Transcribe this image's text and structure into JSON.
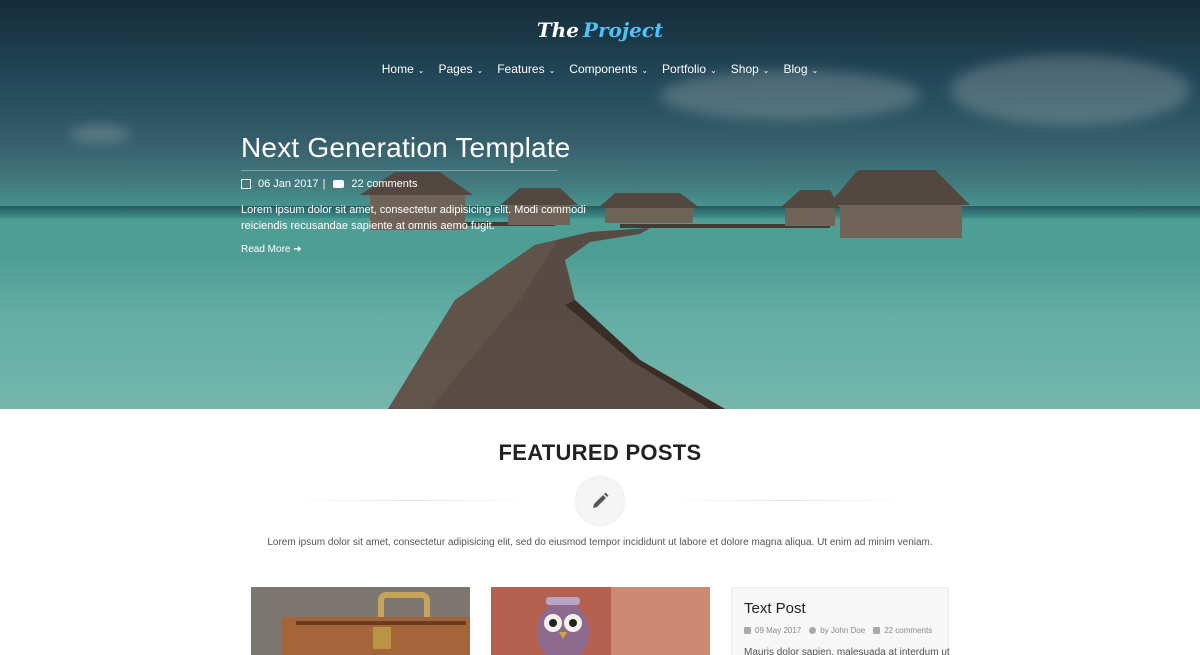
{
  "brand": {
    "name_part1": "The",
    "name_part2": "Project"
  },
  "nav": {
    "items": [
      {
        "label": "Home"
      },
      {
        "label": "Pages"
      },
      {
        "label": "Features"
      },
      {
        "label": "Components"
      },
      {
        "label": "Portfolio"
      },
      {
        "label": "Shop"
      },
      {
        "label": "Blog"
      }
    ]
  },
  "hero": {
    "title": "Next Generation Template",
    "date": "06 Jan 2017",
    "separator": "|",
    "comments": "22 comments",
    "description": "Lorem ipsum dolor sit amet, consectetur adipisicing elit. Modi commodi reiciendis recusandae sapiente at omnis aemo fugit.",
    "read_more": "Read More"
  },
  "featured": {
    "title": "FEATURED POSTS",
    "description": "Lorem ipsum dolor sit amet, consectetur adipisicing elit, sed do eiusmod tempor incididunt ut labore et dolore magna aliqua. Ut enim ad minim veniam."
  },
  "text_post": {
    "title": "Text Post",
    "date": "09 May 2017",
    "author": "by John Doe",
    "comments": "22 comments",
    "excerpt": "Mauris dolor sapien, malesuada at interdum ut"
  },
  "colors": {
    "accent": "#4fc3f7",
    "sea": "#4fa9a0",
    "sky": "#1b3646"
  },
  "icons": [
    "chevron-down-icon",
    "calendar-icon",
    "comments-icon",
    "arrow-right-icon",
    "pencil-icon",
    "user-icon"
  ]
}
